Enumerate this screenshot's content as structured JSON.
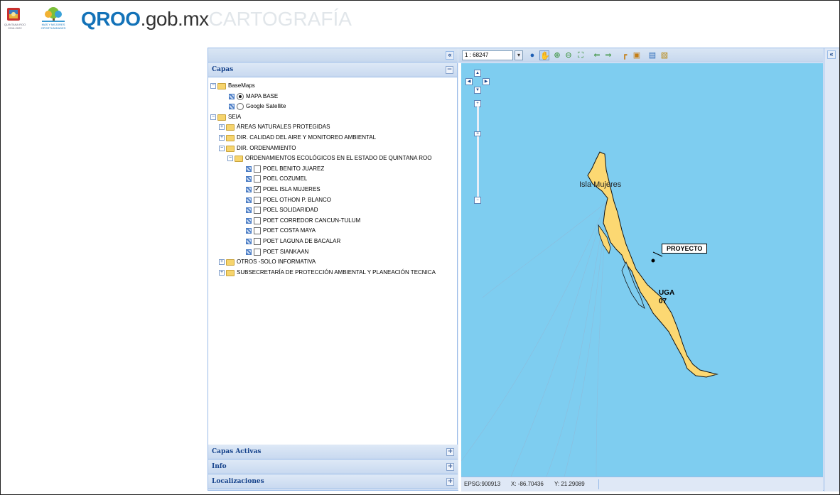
{
  "header": {
    "crest_text": "QUINTANA ROO 2016-2022",
    "tree_text": "MÁS Y MEJORES OPORTUNIDADES",
    "brand_main": "QROO",
    "brand_domain": ".gob.mx",
    "brand_sub": "CARTOGRAFÍA"
  },
  "panels": {
    "layers_title": "Capas",
    "active_layers_title": "Capas Activas",
    "info_title": "Info",
    "locations_title": "Localizaciones"
  },
  "tree": {
    "basemaps": "BaseMaps",
    "mapa_base": "MAPA BASE",
    "google_satellite": "Google Satellite",
    "seia": "SEIA",
    "anp": "ÁREAS NATURALES PROTEGIDAS",
    "calidad_aire": "DIR. CALIDAD DEL AIRE Y MONITOREO AMBIENTAL",
    "ordenamiento": "DIR. ORDENAMIENTO",
    "ordenamientos_eco": "ORDENAMIENTOS ECOLÓGICOS EN EL ESTADO DE QUINTANA ROO",
    "layers": [
      {
        "label": "POEL BENITO JUAREZ",
        "checked": false
      },
      {
        "label": "POEL COZUMEL",
        "checked": false
      },
      {
        "label": "POEL ISLA MUJERES",
        "checked": true
      },
      {
        "label": "POEL OTHON P. BLANCO",
        "checked": false
      },
      {
        "label": "POEL SOLIDARIDAD",
        "checked": false
      },
      {
        "label": "POET CORREDOR CANCUN-TULUM",
        "checked": false
      },
      {
        "label": "POET COSTA MAYA",
        "checked": false
      },
      {
        "label": "POET LAGUNA DE BACALAR",
        "checked": false
      },
      {
        "label": "POET SIANKAAN",
        "checked": false
      }
    ],
    "otros": "OTROS -SOLO INFORMATIVA",
    "subsecretaria": "SUBSECRETARÍA DE PROTECCIÓN AMBIENTAL Y PLANEACIÓN TECNICA"
  },
  "map": {
    "scale": "1 : 68247",
    "place_label": "Isla Mujeres",
    "project_label": "PROYECTO",
    "uga_label_1": "UGA",
    "uga_label_2": "07",
    "water_color": "#7ecdf0",
    "land_color": "#fcd872"
  },
  "status": {
    "epsg": "EPSG:900913",
    "x": "X: -86.70436",
    "y": "Y: 21.29089"
  },
  "icons": {
    "collapse": "«",
    "expand_tree": "⊟",
    "plus": "+",
    "minus": "−",
    "check": "✓"
  }
}
